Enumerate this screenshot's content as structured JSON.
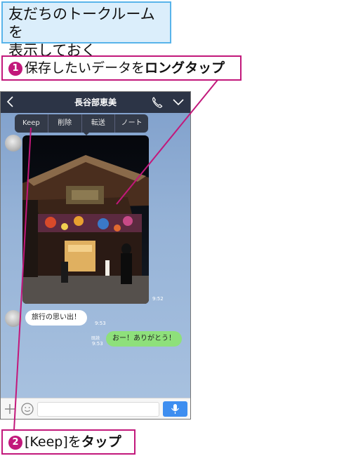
{
  "title_box": {
    "line1": "友だちのトークルームを",
    "line2": "表示しておく"
  },
  "callout1": {
    "num": "1",
    "text": "保存したいデータを",
    "bold": "ロングタップ"
  },
  "callout2": {
    "num": "2",
    "text": "[Keep]を",
    "bold": "タップ"
  },
  "chat": {
    "title": "長谷部恵美",
    "context_menu": [
      "Keep",
      "削除",
      "転送",
      "ノート"
    ],
    "photo_time": "9:52",
    "messages": [
      {
        "text": "旅行の思い出！",
        "time": "9:53"
      },
      {
        "text": "おー！ありがとう！",
        "read": "既読",
        "time": "9:53"
      }
    ]
  },
  "icons": [
    "back-icon",
    "phone-icon",
    "chevron-down-icon",
    "plus-icon",
    "emoji-icon",
    "microphone-icon"
  ],
  "colors": {
    "accent": "#c2187b",
    "box_fill": "#dbeefb",
    "box_border": "#58b4ea",
    "own_bubble": "#8ee07b",
    "header": "#2c3446"
  }
}
